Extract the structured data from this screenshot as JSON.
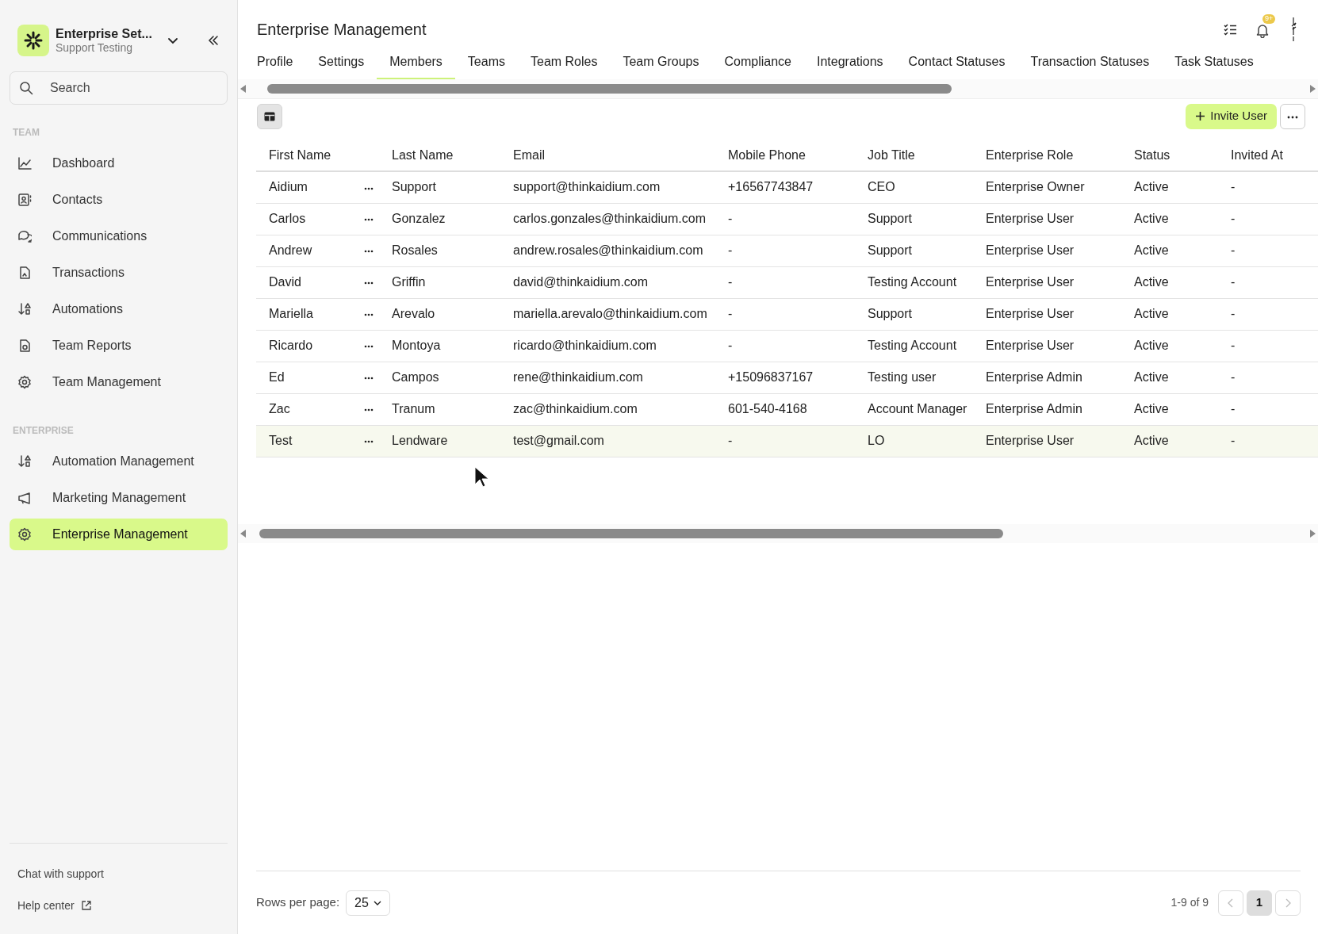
{
  "sidebar": {
    "workspace": {
      "title": "Enterprise Set...",
      "subtitle": "Support Testing"
    },
    "search": {
      "placeholder": "Search"
    },
    "sections": [
      {
        "heading": "TEAM",
        "items": [
          {
            "label": "Dashboard",
            "selected": false
          },
          {
            "label": "Contacts",
            "selected": false
          },
          {
            "label": "Communications",
            "selected": false
          },
          {
            "label": "Transactions",
            "selected": false
          },
          {
            "label": "Automations",
            "selected": false
          },
          {
            "label": "Team Reports",
            "selected": false
          },
          {
            "label": "Team Management",
            "selected": false
          }
        ]
      },
      {
        "heading": "ENTERPRISE",
        "items": [
          {
            "label": "Automation Management",
            "selected": false
          },
          {
            "label": "Marketing Management",
            "selected": false
          },
          {
            "label": "Enterprise Management",
            "selected": true
          }
        ]
      }
    ],
    "footer_links": [
      "Chat with support",
      "Help center"
    ]
  },
  "header": {
    "title": "Enterprise Management",
    "notification_badge": "9+"
  },
  "tabs": [
    {
      "label": "Profile",
      "selected": false
    },
    {
      "label": "Settings",
      "selected": false
    },
    {
      "label": "Members",
      "selected": true
    },
    {
      "label": "Teams",
      "selected": false
    },
    {
      "label": "Team Roles",
      "selected": false
    },
    {
      "label": "Team Groups",
      "selected": false
    },
    {
      "label": "Compliance",
      "selected": false
    },
    {
      "label": "Integrations",
      "selected": false
    },
    {
      "label": "Contact Statuses",
      "selected": false
    },
    {
      "label": "Transaction Statuses",
      "selected": false
    },
    {
      "label": "Task Statuses",
      "selected": false
    }
  ],
  "toolbar": {
    "invite_button": "Invite User"
  },
  "table": {
    "columns": [
      "First Name",
      "Last Name",
      "Email",
      "Mobile Phone",
      "Job Title",
      "Enterprise Role",
      "Status",
      "Invited At"
    ],
    "rows": [
      {
        "cells": [
          "Aidium",
          "Support",
          "support@thinkaidium.com",
          "+16567743847",
          "CEO",
          "Enterprise Owner",
          "Active",
          "-"
        ],
        "hovered": false
      },
      {
        "cells": [
          "Carlos",
          "Gonzalez",
          "carlos.gonzales@thinkaidium.com",
          "-",
          "Support",
          "Enterprise User",
          "Active",
          "-"
        ],
        "hovered": false
      },
      {
        "cells": [
          "Andrew",
          "Rosales",
          "andrew.rosales@thinkaidium.com",
          "-",
          "Support",
          "Enterprise User",
          "Active",
          "-"
        ],
        "hovered": false
      },
      {
        "cells": [
          "David",
          "Griffin",
          "david@thinkaidium.com",
          "-",
          "Testing Account",
          "Enterprise User",
          "Active",
          "-"
        ],
        "hovered": false
      },
      {
        "cells": [
          "Mariella",
          "Arevalo",
          "mariella.arevalo@thinkaidium.com",
          "-",
          "Support",
          "Enterprise User",
          "Active",
          "-"
        ],
        "hovered": false
      },
      {
        "cells": [
          "Ricardo",
          "Montoya",
          "ricardo@thinkaidium.com",
          "-",
          "Testing Account",
          "Enterprise User",
          "Active",
          "-"
        ],
        "hovered": false
      },
      {
        "cells": [
          "Ed",
          "Campos",
          "rene@thinkaidium.com",
          "+15096837167",
          "Testing user",
          "Enterprise Admin",
          "Active",
          "-"
        ],
        "hovered": false
      },
      {
        "cells": [
          "Zac",
          "Tranum",
          "zac@thinkaidium.com",
          "601-540-4168",
          "Account Manager",
          "Enterprise Admin",
          "Active",
          "-"
        ],
        "hovered": false
      },
      {
        "cells": [
          "Test",
          "Lendware",
          "test@gmail.com",
          "-",
          "LO",
          "Enterprise User",
          "Active",
          "-"
        ],
        "hovered": true
      }
    ]
  },
  "pagination": {
    "rows_per_page_label": "Rows per page:",
    "rows_per_page": "25",
    "range": "1-9 of 9",
    "pages": [
      {
        "label": "1",
        "selected": true
      }
    ]
  }
}
